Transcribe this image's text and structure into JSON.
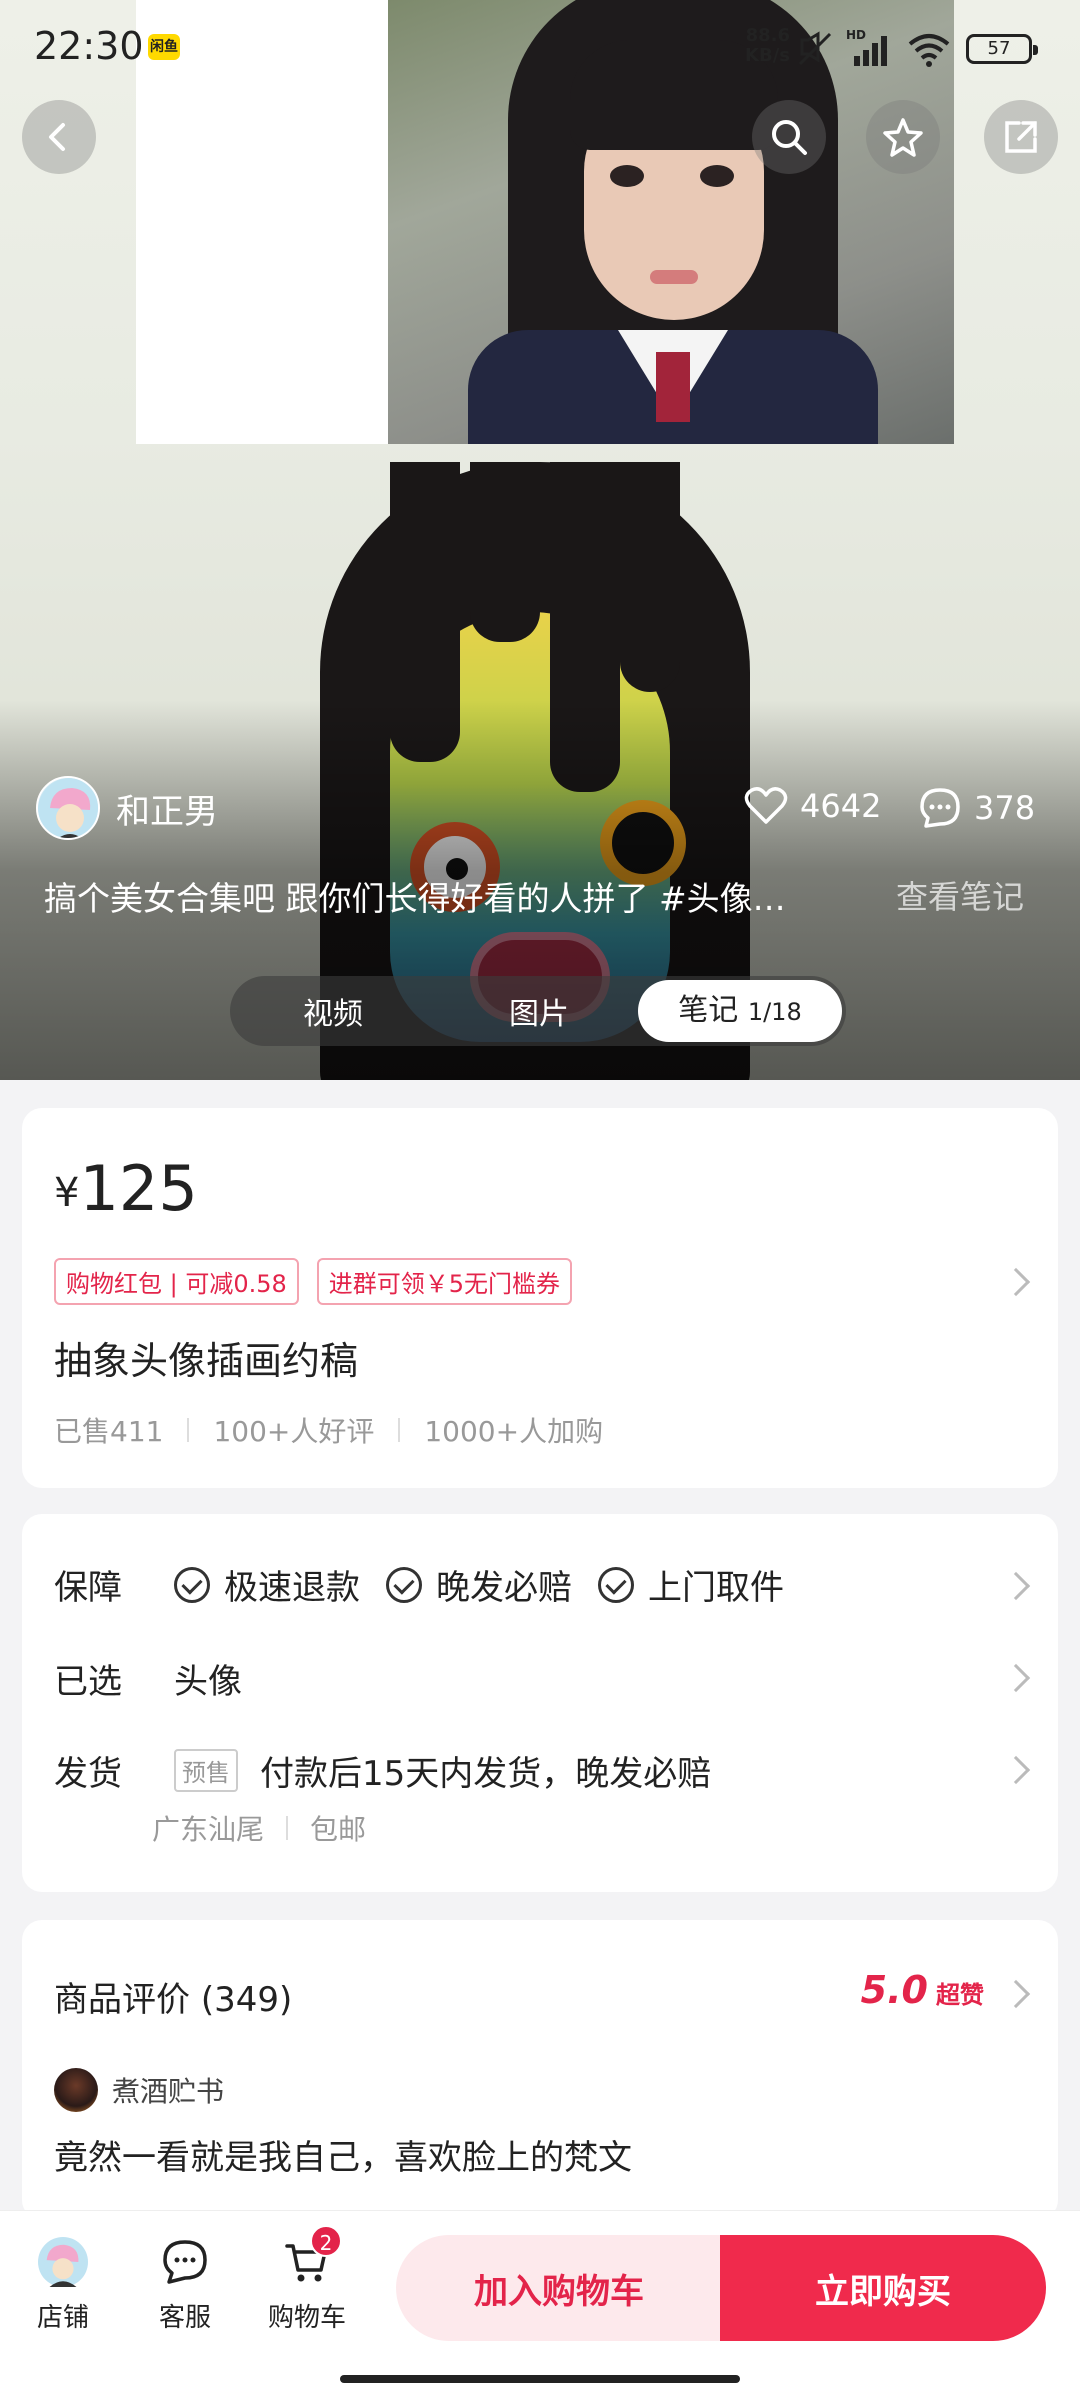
{
  "status_bar": {
    "time": "22:30",
    "app_badge": "闲鱼",
    "net_speed_value": "88.6",
    "net_speed_unit": "KB/s",
    "signal_label": "HD",
    "battery": "57"
  },
  "nav": {
    "back_icon": "chevron-left-icon",
    "search_icon": "search-icon",
    "favorite_icon": "star-icon",
    "share_icon": "share-icon"
  },
  "note": {
    "author": "和正男",
    "likes": "4642",
    "comments": "378",
    "caption": "搞个美女合集吧 跟你们长得好看的人拼了 #头像…",
    "view_note": "查看笔记"
  },
  "media_tabs": {
    "video": "视频",
    "image": "图片",
    "note": "笔记",
    "note_counter": "1/18"
  },
  "product": {
    "currency": "¥",
    "price": "125",
    "tags": [
      "购物红包 | 可减0.58",
      "进群可领￥5无门槛券"
    ],
    "title": "抽象头像插画约稿",
    "sold": "已售411",
    "good_reviews": "100+人好评",
    "added": "1000+人加购"
  },
  "service": {
    "guarantee_label": "保障",
    "guarantees": [
      "极速退款",
      "晚发必赔",
      "上门取件"
    ],
    "selected_label": "已选",
    "selected_value": "头像",
    "shipping_label": "发货",
    "presale_badge": "预售",
    "shipping_value": "付款后15天内发货，晚发必赔",
    "origin": "广东汕尾",
    "free_shipping": "包邮"
  },
  "reviews": {
    "title": "商品评价",
    "count": "(349)",
    "score": "5.0",
    "score_label": "超赞",
    "reviewer": "煮酒贮书",
    "text": "竟然一看就是我自己，喜欢脸上的梵文"
  },
  "bottom_bar": {
    "store": "店铺",
    "service": "客服",
    "cart": "购物车",
    "cart_count": "2",
    "add_to_cart": "加入购物车",
    "buy_now": "立即购买"
  },
  "colors": {
    "accent": "#f02a4c",
    "accent_light": "#fde9ec"
  }
}
